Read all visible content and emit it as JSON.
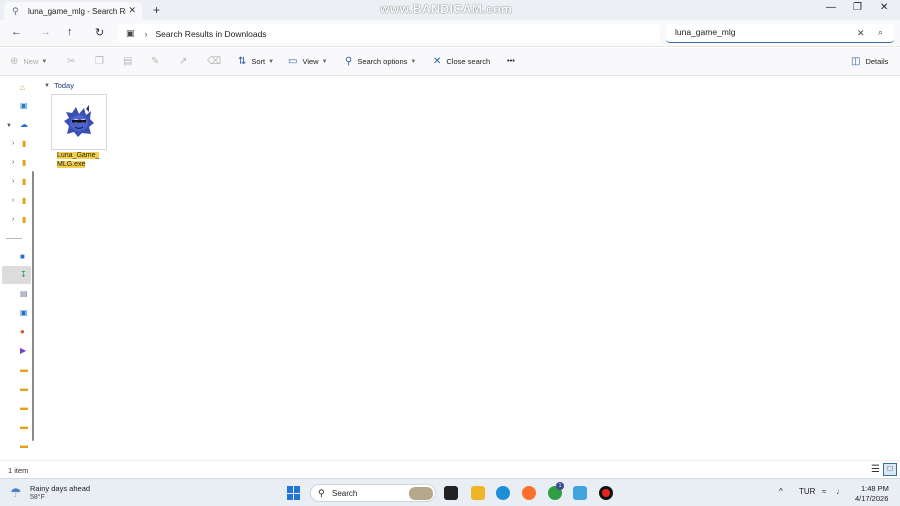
{
  "window": {
    "tab_title": "luna_game_mlg - Search Resu",
    "tab_close": "✕",
    "new_tab": "+",
    "watermark": "www.BANDICAM.com",
    "minimize": "—",
    "maximize": "❐",
    "close": "✕"
  },
  "address": {
    "crumb_sep": "›",
    "breadcrumb": "Search Results in Downloads",
    "search_value": "luna_game_mlg",
    "search_clear": "✕",
    "search_go": "⌕"
  },
  "toolbar": {
    "new_label": "New",
    "sort_label": "Sort",
    "view_label": "View",
    "search_options_label": "Search options",
    "close_search_label": "Close search",
    "more_label": "•••",
    "details_label": "Details"
  },
  "content": {
    "group_label": "Today",
    "files": [
      {
        "name": "Luna_Game_MLG.exe"
      }
    ]
  },
  "status": {
    "item_count": "1 item"
  },
  "taskbar": {
    "weather_title": "Rainy days ahead",
    "weather_temp": "58°F",
    "search_label": "Search",
    "lang": "TUR",
    "time": "1:48 PM",
    "date": "4/17/2026",
    "tray_arrow": "^",
    "chrome_badge": "1"
  },
  "colors": {
    "accent": "#1f75d8",
    "selection_highlight": "#f4cf49",
    "window_bg": "#f9f9fb"
  }
}
